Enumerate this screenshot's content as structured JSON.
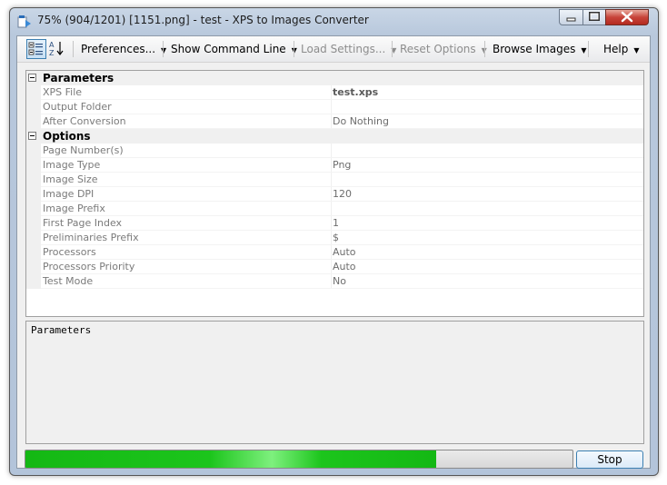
{
  "window": {
    "title": "75% (904/1201) [1151.png] - test - XPS to Images Converter"
  },
  "toolbar": {
    "preferences": "Preferences...",
    "show_command_line": "Show Command Line",
    "load_settings": "Load Settings...",
    "reset_options": "Reset Options",
    "browse_images": "Browse Images",
    "help": "Help"
  },
  "grid": {
    "categories": [
      {
        "name": "Parameters",
        "rows": [
          {
            "name": "XPS File",
            "value": "test.xps"
          },
          {
            "name": "Output Folder",
            "value": ""
          },
          {
            "name": "After Conversion",
            "value": "Do Nothing"
          }
        ]
      },
      {
        "name": "Options",
        "rows": [
          {
            "name": "Page Number(s)",
            "value": ""
          },
          {
            "name": "Image Type",
            "value": "Png"
          },
          {
            "name": "Image Size",
            "value": ""
          },
          {
            "name": "Image DPI",
            "value": "120"
          },
          {
            "name": "Image Prefix",
            "value": ""
          },
          {
            "name": "First Page Index",
            "value": "1"
          },
          {
            "name": "Preliminaries Prefix",
            "value": "$"
          },
          {
            "name": "Processors",
            "value": "Auto"
          },
          {
            "name": "Processors Priority",
            "value": "Auto"
          },
          {
            "name": "Test Mode",
            "value": "No"
          }
        ]
      }
    ]
  },
  "description": {
    "title": "Parameters"
  },
  "progress": {
    "fraction": 0.75
  },
  "stop_label": "Stop",
  "colors": {
    "progress_green": "#1cc51c",
    "focus_blue": "#3c7fb1"
  }
}
